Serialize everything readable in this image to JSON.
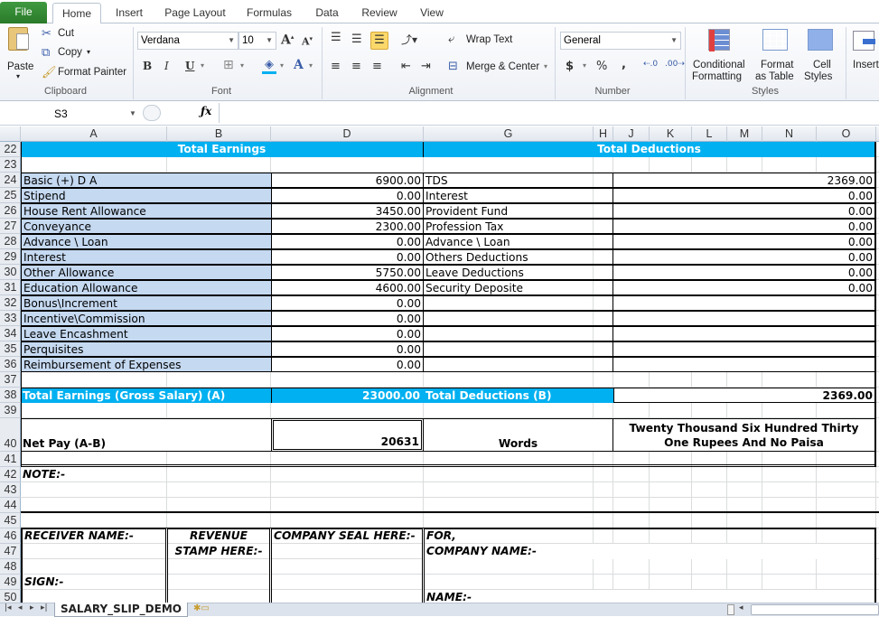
{
  "ribbon": {
    "tabs": [
      "File",
      "Home",
      "Insert",
      "Page Layout",
      "Formulas",
      "Data",
      "Review",
      "View"
    ],
    "clipboard": {
      "paste": "Paste",
      "cut": "Cut",
      "copy": "Copy",
      "format_painter": "Format Painter",
      "label": "Clipboard"
    },
    "font": {
      "name": "Verdana",
      "size": "10",
      "label": "Font",
      "bold": "B",
      "italic": "I",
      "underline": "U"
    },
    "alignment": {
      "wrap_text": "Wrap Text",
      "merge_center": "Merge & Center",
      "label": "Alignment"
    },
    "number": {
      "format": "General",
      "currency": "$",
      "percent": "%",
      "comma": ",",
      "label": "Number"
    },
    "styles": {
      "conditional": "Conditional",
      "conditional2": "Formatting",
      "format_table": "Format",
      "format_table2": "as Table",
      "cell_styles": "Cell",
      "cell_styles2": "Styles",
      "label": "Styles"
    },
    "cells": {
      "insert": "Insert"
    }
  },
  "formula_bar": {
    "name_box": "S3",
    "fx": "fx",
    "value": ""
  },
  "columns": [
    "A",
    "B",
    "D",
    "G",
    "H",
    "J",
    "K",
    "L",
    "M",
    "N",
    "O"
  ],
  "rows": [
    "22",
    "23",
    "24",
    "25",
    "26",
    "27",
    "28",
    "29",
    "30",
    "31",
    "32",
    "33",
    "34",
    "35",
    "36",
    "37",
    "38",
    "39",
    "40",
    "41",
    "42",
    "43",
    "44",
    "45",
    "46",
    "47",
    "48",
    "49",
    "50"
  ],
  "sheet": {
    "earnings_title": "Total Earnings",
    "deductions_title": "Total Deductions",
    "earnings": [
      {
        "label": "Basic (+) D A",
        "value": "6900.00"
      },
      {
        "label": "Stipend",
        "value": "0.00"
      },
      {
        "label": "House Rent Allowance",
        "value": "3450.00"
      },
      {
        "label": "Conveyance",
        "value": "2300.00"
      },
      {
        "label": "Advance \\ Loan",
        "value": "0.00"
      },
      {
        "label": "Interest",
        "value": "0.00"
      },
      {
        "label": "Other Allowance",
        "value": "5750.00"
      },
      {
        "label": "Education Allowance",
        "value": "4600.00"
      },
      {
        "label": "Bonus\\Increment",
        "value": "0.00"
      },
      {
        "label": "Incentive\\Commission",
        "value": "0.00"
      },
      {
        "label": "Leave Encashment",
        "value": "0.00"
      },
      {
        "label": "Perquisites",
        "value": "0.00"
      },
      {
        "label": "Reimbursement of Expenses",
        "value": "0.00"
      }
    ],
    "deductions": [
      {
        "label": "TDS",
        "value": "2369.00"
      },
      {
        "label": "Interest",
        "value": "0.00"
      },
      {
        "label": "Provident Fund",
        "value": "0.00"
      },
      {
        "label": "Profession Tax",
        "value": "0.00"
      },
      {
        "label": "Advance \\ Loan",
        "value": "0.00"
      },
      {
        "label": "Others Deductions",
        "value": "0.00"
      },
      {
        "label": "Leave Deductions",
        "value": "0.00"
      },
      {
        "label": "Security Deposite",
        "value": "0.00"
      }
    ],
    "total_earnings_label": "Total Earnings (Gross Salary) (A)",
    "total_earnings_value": "23000.00",
    "total_deductions_label": "Total Deductions (B)",
    "total_deductions_value": "2369.00",
    "net_pay_label": "Net Pay (A-B)",
    "net_pay_value": "20631",
    "words_label": "Words",
    "words_line1": "Twenty Thousand Six Hundred Thirty",
    "words_line2": "One Rupees And No Paisa",
    "note": "NOTE:-",
    "receiver_name": "RECEIVER NAME:-",
    "revenue_stamp1": "REVENUE",
    "revenue_stamp2": "STAMP HERE:-",
    "company_seal": "COMPANY SEAL HERE:-",
    "for": "FOR,",
    "company_name": "COMPANY NAME:-",
    "sign": "SIGN:-",
    "name": "NAME:-"
  },
  "sheet_tabs": {
    "active": "SALARY_SLIP_DEMO"
  },
  "colors": {
    "header_blue": "#00b0f0",
    "label_blue": "#c5d9f1"
  }
}
